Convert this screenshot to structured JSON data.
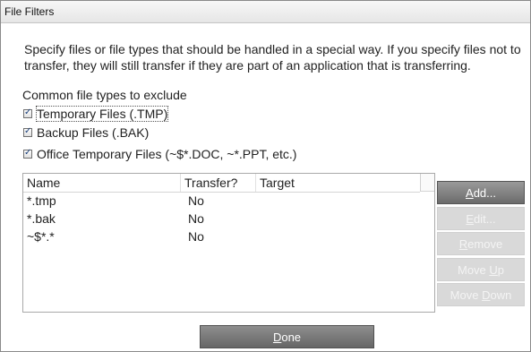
{
  "window": {
    "title": "File Filters"
  },
  "intro": {
    "text": "Specify files or file types that should be handled in a special way. If you specify files not to transfer, they will still transfer if they are part of an application that is transferring."
  },
  "exclude_section": {
    "heading": "Common file types to exclude",
    "options": [
      {
        "label": "Temporary Files (.TMP)",
        "checked": true,
        "focused": true
      },
      {
        "label": "Backup Files (.BAK)",
        "checked": true,
        "focused": false
      },
      {
        "label": "Office Temporary Files (~$*.DOC, ~*.PPT, etc.)",
        "checked": true,
        "focused": false
      }
    ]
  },
  "file_list": {
    "columns": [
      "Name",
      "Transfer?",
      "Target"
    ],
    "rows": [
      {
        "name": "*.tmp",
        "transfer": "No",
        "target": ""
      },
      {
        "name": "*.bak",
        "transfer": "No",
        "target": ""
      },
      {
        "name": "~$*.*",
        "transfer": "No",
        "target": ""
      }
    ]
  },
  "buttons": {
    "add": {
      "pre": "",
      "key": "A",
      "post": "dd...",
      "enabled": true
    },
    "edit": {
      "pre": "",
      "key": "E",
      "post": "dit...",
      "enabled": false
    },
    "remove": {
      "pre": "",
      "key": "R",
      "post": "emove",
      "enabled": false
    },
    "move_up": {
      "pre": "Move ",
      "key": "U",
      "post": "p",
      "enabled": false
    },
    "move_down": {
      "pre": "Move ",
      "key": "D",
      "post": "own",
      "enabled": false
    },
    "done": {
      "pre": "",
      "key": "D",
      "post": "one",
      "enabled": true
    }
  },
  "colors": {
    "enabled_button": "#7a7a7a",
    "disabled_button": "#d9d9d9",
    "checkmark": "#1a3f7a"
  }
}
